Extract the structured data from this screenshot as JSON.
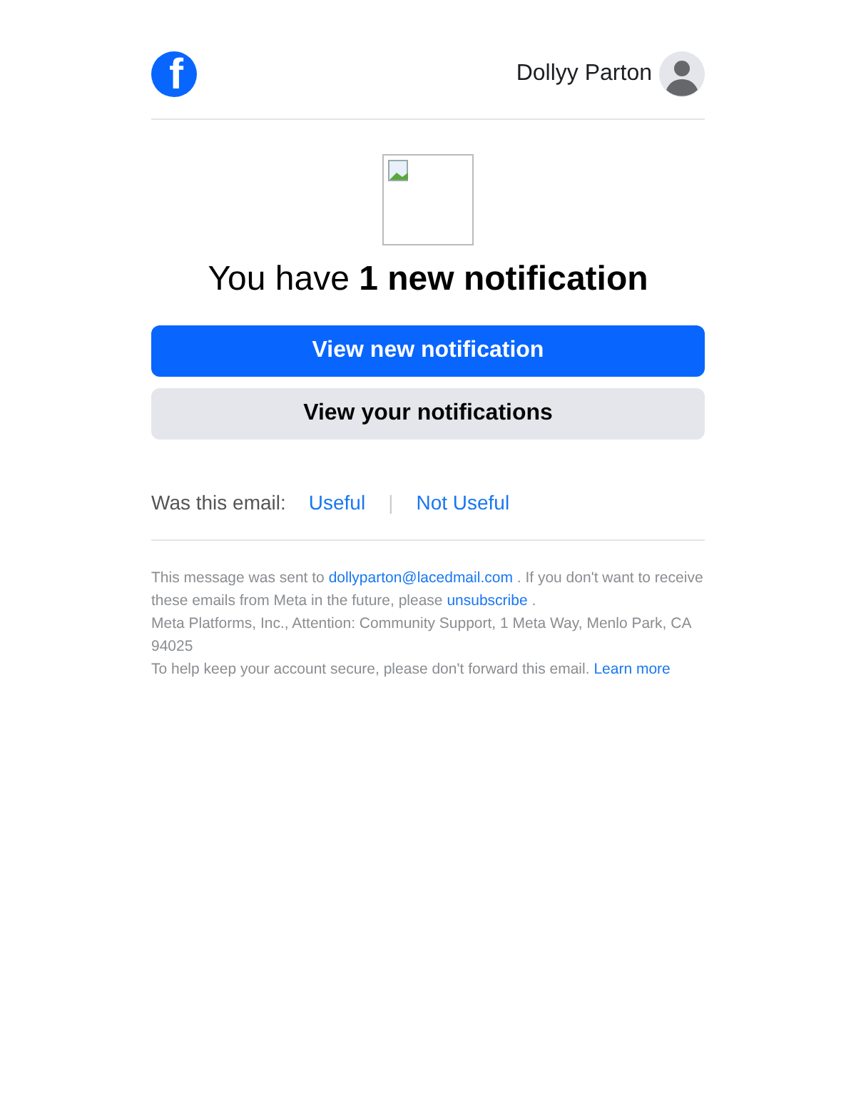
{
  "header": {
    "logo": "f",
    "user_name": "Dollyy Parton"
  },
  "headline": "You have **1 new notification**",
  "buttons": [
    {
      "label": "View new notification",
      "kind": "primary"
    },
    {
      "label": "View your notifications",
      "kind": "secondary"
    }
  ],
  "feedback": {
    "prompt": "Was this email:",
    "options": [
      "Useful",
      "Not Useful"
    ],
    "separator": "|"
  },
  "footer": {
    "sent_to_prefix": "This message was sent to",
    "email": "dollyparton@lacedmail.com",
    "sent_to_middle": ". If you don't want to receive these emails from Meta in the future, please",
    "unsubscribe": "unsubscribe",
    "sent_to_end": ".",
    "address": "Meta Platforms, Inc., Attention: Community Support, 1 Meta Way, Menlo Park, CA 94025",
    "security": "To help keep your account secure, please don't forward this email.",
    "learn_more": "Learn more"
  }
}
